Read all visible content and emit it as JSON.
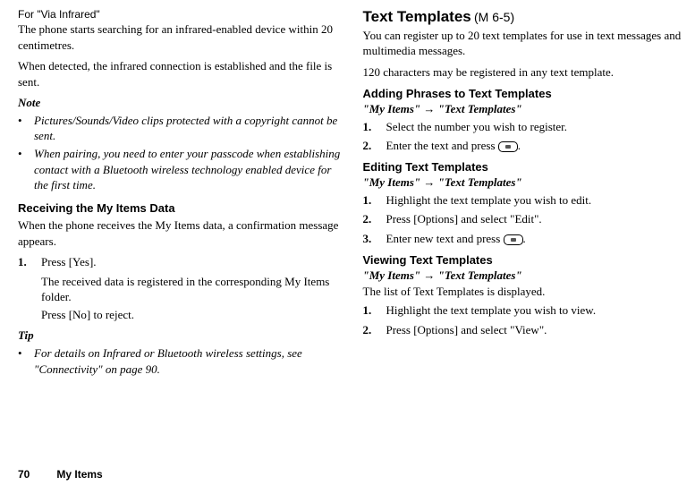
{
  "left": {
    "forVia": "For \"Via Infrared\"",
    "paraSearch": "The phone starts searching for an infrared-enabled device within 20 centimetres.",
    "paraDetected": "When detected, the infrared connection is established and the file is sent.",
    "noteLabel": "Note",
    "noteItems": [
      "Pictures/Sounds/Video clips protected with a copyright cannot be sent.",
      "When pairing, you need to enter your passcode when establishing contact with a Bluetooth wireless technology enabled device for the first time."
    ],
    "recvHeading": "Receiving the My Items Data",
    "recvIntro": "When the phone receives the My Items data, a confirmation message appears.",
    "recvStep1": "Press [Yes].",
    "recvSub1": "The received data is registered in the corresponding My Items folder.",
    "recvSub2": "Press [No] to reject.",
    "tipLabel": "Tip",
    "tipItem": "For details on Infrared or Bluetooth wireless settings, see \"Connectivity\" on page 90."
  },
  "right": {
    "title": "Text Templates",
    "titleCode": "(M 6-5)",
    "intro1": "You can register up to 20 text templates for use in text messages and multimedia messages.",
    "intro2": "120 characters may be registered in any text template.",
    "addHeading": "Adding Phrases to Text Templates",
    "pathAdd_a": "\"My Items\"",
    "pathAdd_b": "\"Text Templates\"",
    "addStep1": "Select the number you wish to register.",
    "addStep2a": "Enter the text and press ",
    "period": ".",
    "editHeading": "Editing Text Templates",
    "pathEdit_a": "\"My Items\"",
    "pathEdit_b": "\"Text Templates\"",
    "editStep1": "Highlight the text template you wish to edit.",
    "editStep2": "Press [Options] and select \"Edit\".",
    "editStep3a": "Enter new text and press ",
    "viewHeading": "Viewing Text Templates",
    "pathView_a": "\"My Items\"",
    "pathView_b": "\"Text Templates\"",
    "viewIntro": "The list of Text Templates is displayed.",
    "viewStep1": "Highlight the text template you wish to view.",
    "viewStep2": "Press [Options] and select \"View\"."
  },
  "footer": {
    "page": "70",
    "section": "My Items"
  }
}
